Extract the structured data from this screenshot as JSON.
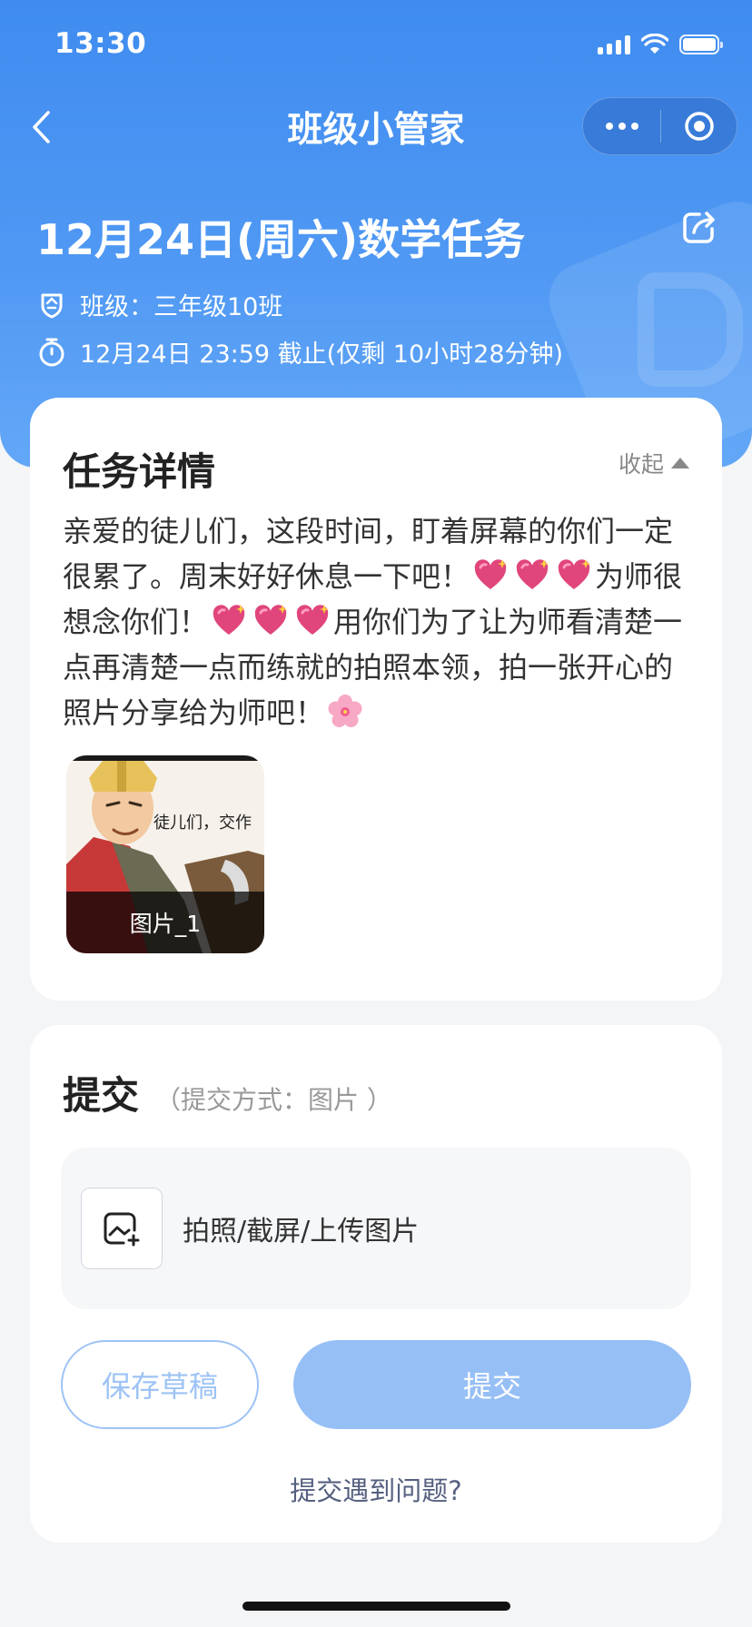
{
  "status_bar": {
    "time": "13:30"
  },
  "nav": {
    "title": "班级小管家"
  },
  "task": {
    "title": "12月24日(周六)数学任务",
    "class_line": "班级：三年级10班",
    "deadline_line": "12月24日 23:59 截止(仅剩 10小时28分钟)"
  },
  "detail": {
    "heading": "任务详情",
    "collapse_label": "收起",
    "text_1": "亲爱的徒儿们，这段时间，盯着屏幕的你们一定很累了。周末好好休息一下吧！",
    "text_2": "为师很想念你们！",
    "text_3": "用你们为了让为师看清楚一点再清楚一点而练就的拍照本领，拍一张开心的照片分享给为师吧！",
    "image": {
      "caption_text": "徒儿们，交作",
      "label": "图片_1"
    }
  },
  "submit": {
    "heading": "提交",
    "method": "（提交方式：图片 ）",
    "upload_label": "拍照/截屏/上传图片",
    "draft_button": "保存草稿",
    "submit_button": "提交",
    "help_link": "提交遇到问题?"
  },
  "colors": {
    "primary_blue": "#4a93f2",
    "submit_disabled": "#96bff6",
    "draft_border": "#9ec3f5"
  }
}
